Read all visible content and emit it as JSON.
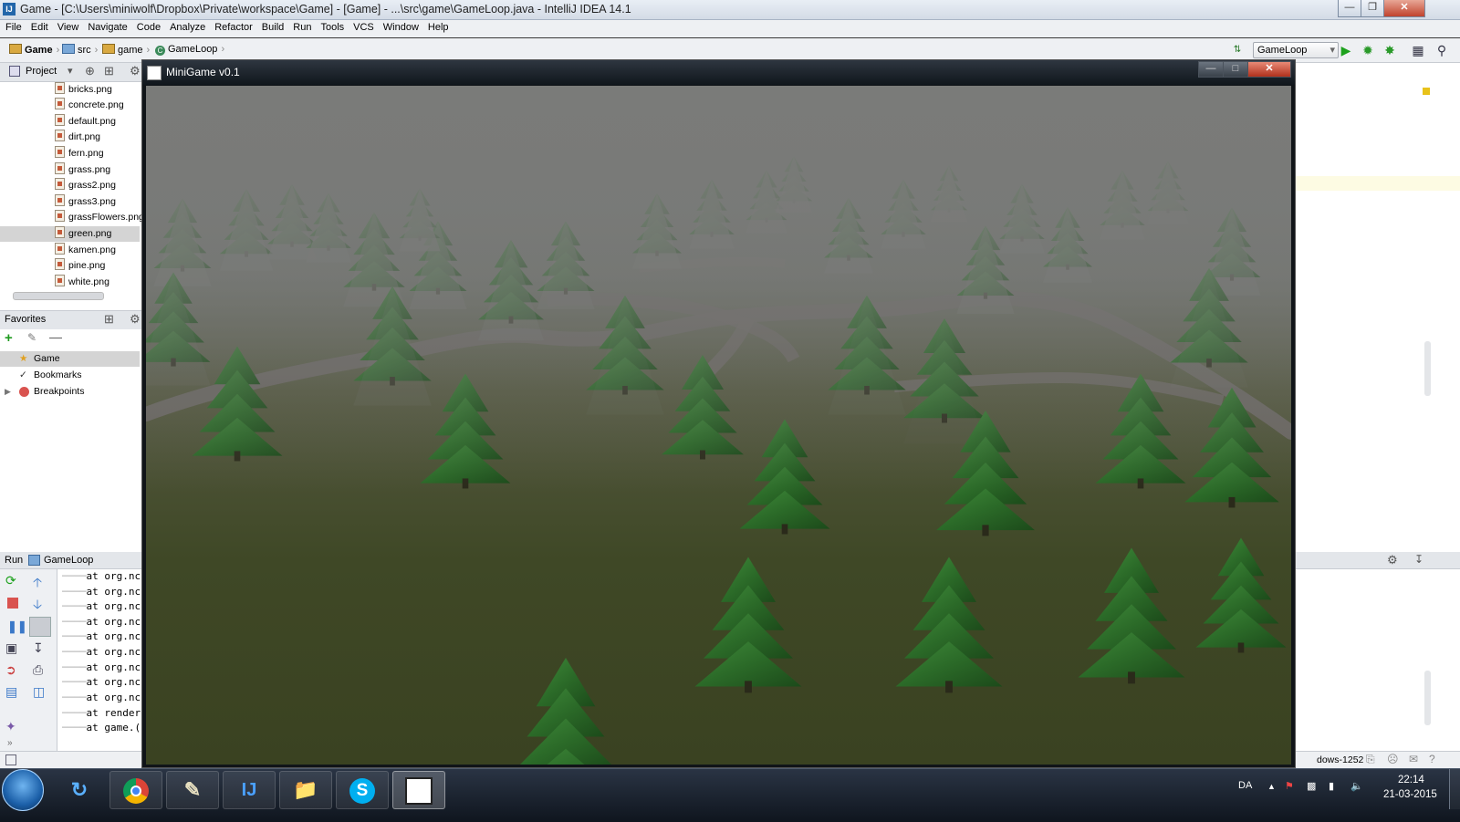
{
  "ide": {
    "window_title": "Game - [C:\\Users\\miniwolf\\Dropbox\\Private\\workspace\\Game] - [Game] - ...\\src\\game\\GameLoop.java - IntelliJ IDEA 14.1",
    "logo_text": "IJ",
    "menu": [
      "File",
      "Edit",
      "View",
      "Navigate",
      "Code",
      "Analyze",
      "Refactor",
      "Build",
      "Run",
      "Tools",
      "VCS",
      "Window",
      "Help"
    ],
    "breadcrumb": [
      "Game",
      "src",
      "game",
      "GameLoop"
    ],
    "run_config": "GameLoop",
    "project_dropdown": "Project",
    "files": [
      "bricks.png",
      "concrete.png",
      "default.png",
      "dirt.png",
      "fern.png",
      "grass.png",
      "grass2.png",
      "grass3.png",
      "grassFlowers.png",
      "green.png",
      "kamen.png",
      "pine.png",
      "white.png"
    ],
    "selected_file": "green.png",
    "favorites": {
      "title": "Favorites",
      "items": [
        "Game",
        "Bookmarks",
        "Breakpoints"
      ]
    },
    "run_panel": {
      "label": "Run",
      "config": "GameLoop",
      "console_lines": [
        "at org.nc",
        "at org.nc",
        "at org.nc",
        "at org.nc",
        "at org.nc",
        "at org.nc",
        "at org.nc",
        "at org.nc",
        "at org.nc",
        "at render",
        "at game.("
      ]
    },
    "status_encoding": "dows-1252"
  },
  "game": {
    "title": "MiniGame v0.1"
  },
  "taskbar": {
    "apps": [
      "chrome",
      "notepad",
      "intellij",
      "explorer",
      "skype",
      "minigame"
    ],
    "language": "DA",
    "time": "22:14",
    "date": "21-03-2015"
  },
  "colors": {
    "fog": "#7d7f7c",
    "grass": "#3e4a24",
    "tree": "#2f6a2a",
    "path": "#6e6866"
  }
}
